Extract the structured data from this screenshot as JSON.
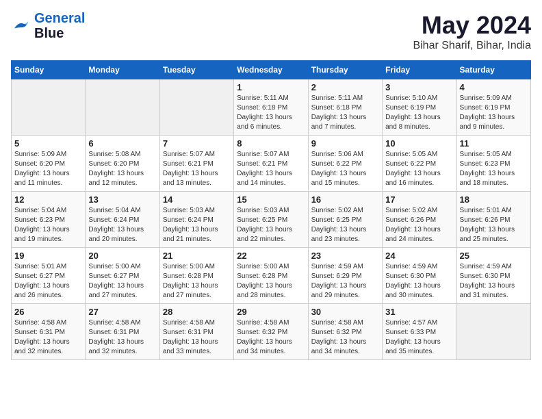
{
  "header": {
    "logo_line1": "General",
    "logo_line2": "Blue",
    "month_year": "May 2024",
    "location": "Bihar Sharif, Bihar, India"
  },
  "weekdays": [
    "Sunday",
    "Monday",
    "Tuesday",
    "Wednesday",
    "Thursday",
    "Friday",
    "Saturday"
  ],
  "weeks": [
    [
      {
        "day": "",
        "info": ""
      },
      {
        "day": "",
        "info": ""
      },
      {
        "day": "",
        "info": ""
      },
      {
        "day": "1",
        "info": "Sunrise: 5:11 AM\nSunset: 6:18 PM\nDaylight: 13 hours\nand 6 minutes."
      },
      {
        "day": "2",
        "info": "Sunrise: 5:11 AM\nSunset: 6:18 PM\nDaylight: 13 hours\nand 7 minutes."
      },
      {
        "day": "3",
        "info": "Sunrise: 5:10 AM\nSunset: 6:19 PM\nDaylight: 13 hours\nand 8 minutes."
      },
      {
        "day": "4",
        "info": "Sunrise: 5:09 AM\nSunset: 6:19 PM\nDaylight: 13 hours\nand 9 minutes."
      }
    ],
    [
      {
        "day": "5",
        "info": "Sunrise: 5:09 AM\nSunset: 6:20 PM\nDaylight: 13 hours\nand 11 minutes."
      },
      {
        "day": "6",
        "info": "Sunrise: 5:08 AM\nSunset: 6:20 PM\nDaylight: 13 hours\nand 12 minutes."
      },
      {
        "day": "7",
        "info": "Sunrise: 5:07 AM\nSunset: 6:21 PM\nDaylight: 13 hours\nand 13 minutes."
      },
      {
        "day": "8",
        "info": "Sunrise: 5:07 AM\nSunset: 6:21 PM\nDaylight: 13 hours\nand 14 minutes."
      },
      {
        "day": "9",
        "info": "Sunrise: 5:06 AM\nSunset: 6:22 PM\nDaylight: 13 hours\nand 15 minutes."
      },
      {
        "day": "10",
        "info": "Sunrise: 5:05 AM\nSunset: 6:22 PM\nDaylight: 13 hours\nand 16 minutes."
      },
      {
        "day": "11",
        "info": "Sunrise: 5:05 AM\nSunset: 6:23 PM\nDaylight: 13 hours\nand 18 minutes."
      }
    ],
    [
      {
        "day": "12",
        "info": "Sunrise: 5:04 AM\nSunset: 6:23 PM\nDaylight: 13 hours\nand 19 minutes."
      },
      {
        "day": "13",
        "info": "Sunrise: 5:04 AM\nSunset: 6:24 PM\nDaylight: 13 hours\nand 20 minutes."
      },
      {
        "day": "14",
        "info": "Sunrise: 5:03 AM\nSunset: 6:24 PM\nDaylight: 13 hours\nand 21 minutes."
      },
      {
        "day": "15",
        "info": "Sunrise: 5:03 AM\nSunset: 6:25 PM\nDaylight: 13 hours\nand 22 minutes."
      },
      {
        "day": "16",
        "info": "Sunrise: 5:02 AM\nSunset: 6:25 PM\nDaylight: 13 hours\nand 23 minutes."
      },
      {
        "day": "17",
        "info": "Sunrise: 5:02 AM\nSunset: 6:26 PM\nDaylight: 13 hours\nand 24 minutes."
      },
      {
        "day": "18",
        "info": "Sunrise: 5:01 AM\nSunset: 6:26 PM\nDaylight: 13 hours\nand 25 minutes."
      }
    ],
    [
      {
        "day": "19",
        "info": "Sunrise: 5:01 AM\nSunset: 6:27 PM\nDaylight: 13 hours\nand 26 minutes."
      },
      {
        "day": "20",
        "info": "Sunrise: 5:00 AM\nSunset: 6:27 PM\nDaylight: 13 hours\nand 27 minutes."
      },
      {
        "day": "21",
        "info": "Sunrise: 5:00 AM\nSunset: 6:28 PM\nDaylight: 13 hours\nand 27 minutes."
      },
      {
        "day": "22",
        "info": "Sunrise: 5:00 AM\nSunset: 6:28 PM\nDaylight: 13 hours\nand 28 minutes."
      },
      {
        "day": "23",
        "info": "Sunrise: 4:59 AM\nSunset: 6:29 PM\nDaylight: 13 hours\nand 29 minutes."
      },
      {
        "day": "24",
        "info": "Sunrise: 4:59 AM\nSunset: 6:30 PM\nDaylight: 13 hours\nand 30 minutes."
      },
      {
        "day": "25",
        "info": "Sunrise: 4:59 AM\nSunset: 6:30 PM\nDaylight: 13 hours\nand 31 minutes."
      }
    ],
    [
      {
        "day": "26",
        "info": "Sunrise: 4:58 AM\nSunset: 6:31 PM\nDaylight: 13 hours\nand 32 minutes."
      },
      {
        "day": "27",
        "info": "Sunrise: 4:58 AM\nSunset: 6:31 PM\nDaylight: 13 hours\nand 32 minutes."
      },
      {
        "day": "28",
        "info": "Sunrise: 4:58 AM\nSunset: 6:31 PM\nDaylight: 13 hours\nand 33 minutes."
      },
      {
        "day": "29",
        "info": "Sunrise: 4:58 AM\nSunset: 6:32 PM\nDaylight: 13 hours\nand 34 minutes."
      },
      {
        "day": "30",
        "info": "Sunrise: 4:58 AM\nSunset: 6:32 PM\nDaylight: 13 hours\nand 34 minutes."
      },
      {
        "day": "31",
        "info": "Sunrise: 4:57 AM\nSunset: 6:33 PM\nDaylight: 13 hours\nand 35 minutes."
      },
      {
        "day": "",
        "info": ""
      }
    ]
  ]
}
